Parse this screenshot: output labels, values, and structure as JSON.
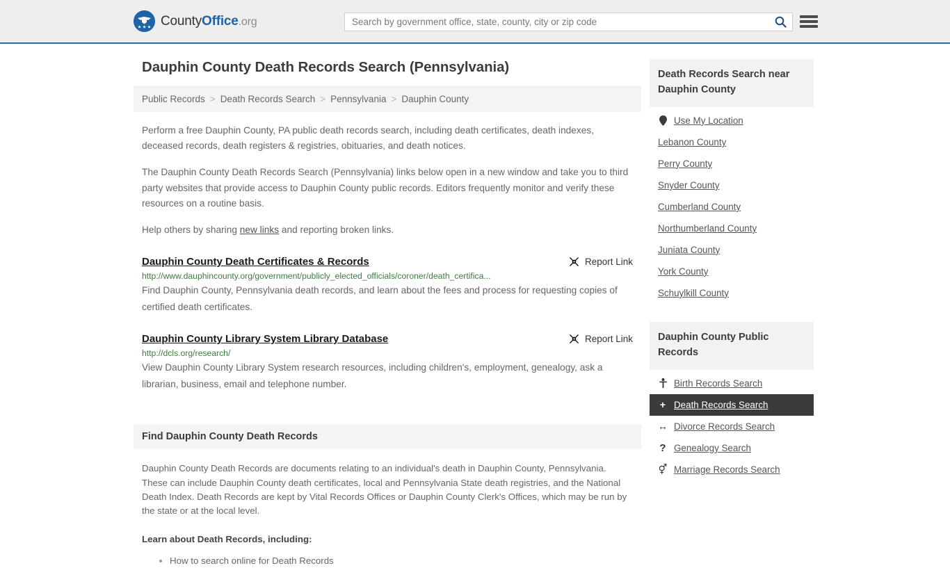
{
  "header": {
    "brand": {
      "part1": "County",
      "part2": "Office",
      "part3": ".org",
      "logo_icon": "eagle-stars-logo"
    },
    "search": {
      "placeholder": "Search by government office, state, county, city or zip code",
      "value": "",
      "icon": "search-icon"
    },
    "menu_icon": "hamburger-menu-icon",
    "accent_color": "#2d6ca2",
    "background_color": "#eeeeee"
  },
  "page_title": "Dauphin County Death Records Search (Pennsylvania)",
  "breadcrumb": {
    "items": [
      {
        "label": "Public Records"
      },
      {
        "label": "Death Records Search"
      },
      {
        "label": "Pennsylvania"
      },
      {
        "label": "Dauphin County"
      }
    ],
    "separator": ">"
  },
  "intro": {
    "p1": "Perform a free Dauphin County, PA public death records search, including death certificates, death indexes, deceased records, death registers & registries, obituaries, and death notices.",
    "p2": "The Dauphin County Death Records Search (Pennsylvania) links below open in a new window and take you to third party websites that provide access to Dauphin County public records. Editors frequently monitor and verify these resources on a routine basis.",
    "p3_before": "Help others by sharing ",
    "p3_link": "new links",
    "p3_after": " and reporting broken links."
  },
  "results": [
    {
      "title": "Dauphin County Death Certificates & Records",
      "url": "http://www.dauphincounty.org/government/publicly_elected_officials/coroner/death_certifica...",
      "description": "Find Dauphin County, Pennsylvania death records, and learn about the fees and process for requesting copies of certified death certificates.",
      "report_label": "Report Link",
      "report_icon": "broken-link-icon"
    },
    {
      "title": "Dauphin County Library System Library Database",
      "url": "http://dcls.org/research/",
      "description": "View Dauphin County Library System research resources, including children's, employment, genealogy, ask a librarian, business, email and telephone number.",
      "report_label": "Report Link",
      "report_icon": "broken-link-icon"
    }
  ],
  "find_section": {
    "heading": "Find Dauphin County Death Records",
    "body": "Dauphin County Death Records are documents relating to an individual's death in Dauphin County, Pennsylvania. These can include Dauphin County death certificates, local and Pennsylvania State death registries, and the National Death Index. Death Records are kept by Vital Records Offices or Dauphin County Clerk's Offices, which may be run by the state or at the local level.",
    "learn_heading": "Learn about Death Records, including:",
    "bullets": [
      "How to search online for Death Records"
    ]
  },
  "sidebar": {
    "near_panel": {
      "heading": "Death Records Search near Dauphin County",
      "use_my_location": {
        "label": "Use My Location",
        "icon": "map-pin-icon"
      },
      "counties": [
        "Lebanon County",
        "Perry County",
        "Snyder County",
        "Cumberland County",
        "Northumberland County",
        "Juniata County",
        "York County",
        "Schuylkill County"
      ]
    },
    "public_records_panel": {
      "heading": "Dauphin County Public Records",
      "items": [
        {
          "label": "Birth Records Search",
          "icon": "baby-icon",
          "glyph": "Ŧ",
          "active": false
        },
        {
          "label": "Death Records Search",
          "icon": "cross-icon",
          "glyph": "+",
          "active": true
        },
        {
          "label": "Divorce Records Search",
          "icon": "left-right-arrow-icon",
          "glyph": "↔",
          "active": false
        },
        {
          "label": "Genealogy Search",
          "icon": "question-mark-icon",
          "glyph": "?",
          "active": false
        },
        {
          "label": "Marriage Records Search",
          "icon": "male-female-icon",
          "glyph": "⚥",
          "active": false
        }
      ]
    }
  }
}
